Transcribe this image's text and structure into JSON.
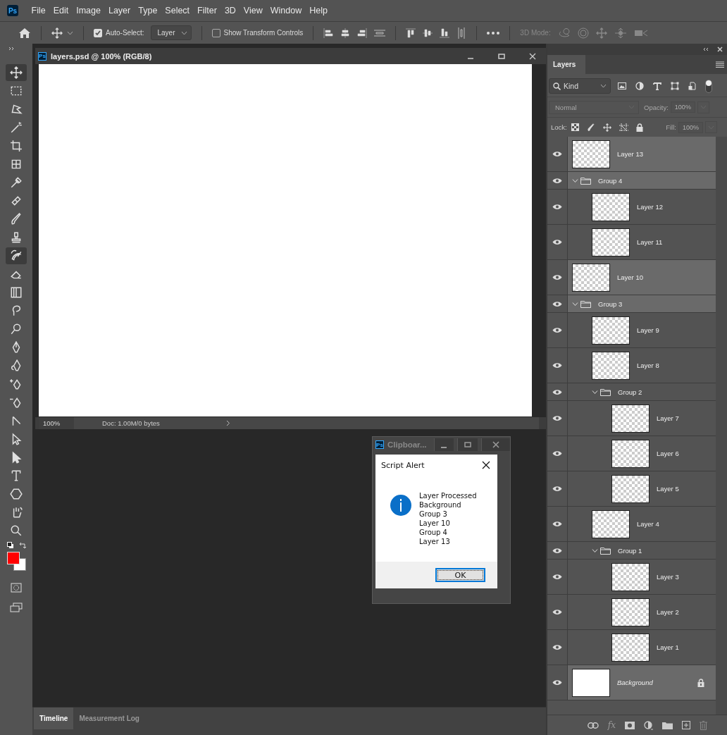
{
  "app_logo": "Ps",
  "menu": [
    "File",
    "Edit",
    "Image",
    "Layer",
    "Type",
    "Select",
    "Filter",
    "3D",
    "View",
    "Window",
    "Help"
  ],
  "options_bar": {
    "auto_select": {
      "label": "Auto-Select:",
      "checked": true
    },
    "target": "Layer",
    "transform_controls": {
      "label": "Show Transform Controls",
      "checked": false
    },
    "mode_label": "3D Mode:"
  },
  "tools": [
    {
      "selected": true
    },
    {
      "selected": false
    },
    {
      "selected": false
    },
    {
      "selected": false
    },
    {
      "selected": false
    },
    {
      "selected": false
    },
    {
      "selected": false
    },
    {
      "selected": false
    },
    {
      "selected": false
    },
    {
      "selected": false
    },
    {
      "selected": true
    },
    {
      "selected": false
    },
    {
      "selected": false
    },
    {
      "selected": false
    },
    {
      "selected": false
    },
    {
      "selected": false
    },
    {
      "selected": false
    },
    {
      "selected": false
    },
    {
      "selected": false
    },
    {
      "selected": false
    },
    {
      "selected": false
    },
    {
      "selected": false
    },
    {
      "selected": false
    },
    {
      "selected": false
    },
    {
      "selected": false
    },
    {
      "selected": false
    }
  ],
  "document": {
    "icon": "Ps",
    "title": "layers.psd @ 100% (RGB/8)",
    "zoom": "100%",
    "info": "Doc: 1.00M/0 bytes"
  },
  "dialog": {
    "icon": "Ps",
    "window_title": "Clipboar...",
    "title": "Script Alert",
    "lines": [
      "Layer Processed",
      "Background",
      "Group 3",
      "Layer 10",
      "Group 4",
      "Layer 13"
    ],
    "ok": "OK"
  },
  "bottom_tabs": [
    {
      "label": "Timeline",
      "selected": true
    },
    {
      "label": "Measurement Log",
      "selected": false
    }
  ],
  "layers_panel": {
    "tab": "Layers",
    "filter": "Kind",
    "blend_mode": "Normal",
    "opacity_label": "Opacity:",
    "opacity": "100%",
    "lock_label": "Lock:",
    "fill_label": "Fill:",
    "fill": "100%",
    "effects_label": "fx",
    "layers": [
      {
        "name": "Layer 13",
        "kind": "layer",
        "selected": true,
        "visible": true
      },
      {
        "name": "Group 4",
        "kind": "group",
        "selected": true,
        "visible": true,
        "expanded": true,
        "children": [
          {
            "name": "Layer 12",
            "kind": "layer",
            "selected": false,
            "visible": true
          },
          {
            "name": "Layer 11",
            "kind": "layer",
            "selected": false,
            "visible": true
          }
        ]
      },
      {
        "name": "Layer 10",
        "kind": "layer",
        "selected": true,
        "visible": true
      },
      {
        "name": "Group 3",
        "kind": "group",
        "selected": true,
        "visible": true,
        "expanded": true,
        "children": [
          {
            "name": "Layer 9",
            "kind": "layer",
            "selected": false,
            "visible": true
          },
          {
            "name": "Layer 8",
            "kind": "layer",
            "selected": false,
            "visible": true
          },
          {
            "name": "Group 2",
            "kind": "group",
            "selected": false,
            "visible": true,
            "expanded": true,
            "children": [
              {
                "name": "Layer 7",
                "kind": "layer",
                "selected": false,
                "visible": true
              },
              {
                "name": "Layer 6",
                "kind": "layer",
                "selected": false,
                "visible": true
              },
              {
                "name": "Layer 5",
                "kind": "layer",
                "selected": false,
                "visible": true
              }
            ]
          },
          {
            "name": "Layer 4",
            "kind": "layer",
            "selected": false,
            "visible": true
          },
          {
            "name": "Group 1",
            "kind": "group",
            "selected": false,
            "visible": true,
            "expanded": true,
            "children": [
              {
                "name": "Layer 3",
                "kind": "layer",
                "selected": false,
                "visible": true
              },
              {
                "name": "Layer 2",
                "kind": "layer",
                "selected": false,
                "visible": true
              },
              {
                "name": "Layer 1",
                "kind": "layer",
                "selected": false,
                "visible": true
              }
            ]
          }
        ]
      },
      {
        "name": "Background",
        "kind": "background",
        "selected": true,
        "visible": true,
        "locked": true
      }
    ]
  }
}
